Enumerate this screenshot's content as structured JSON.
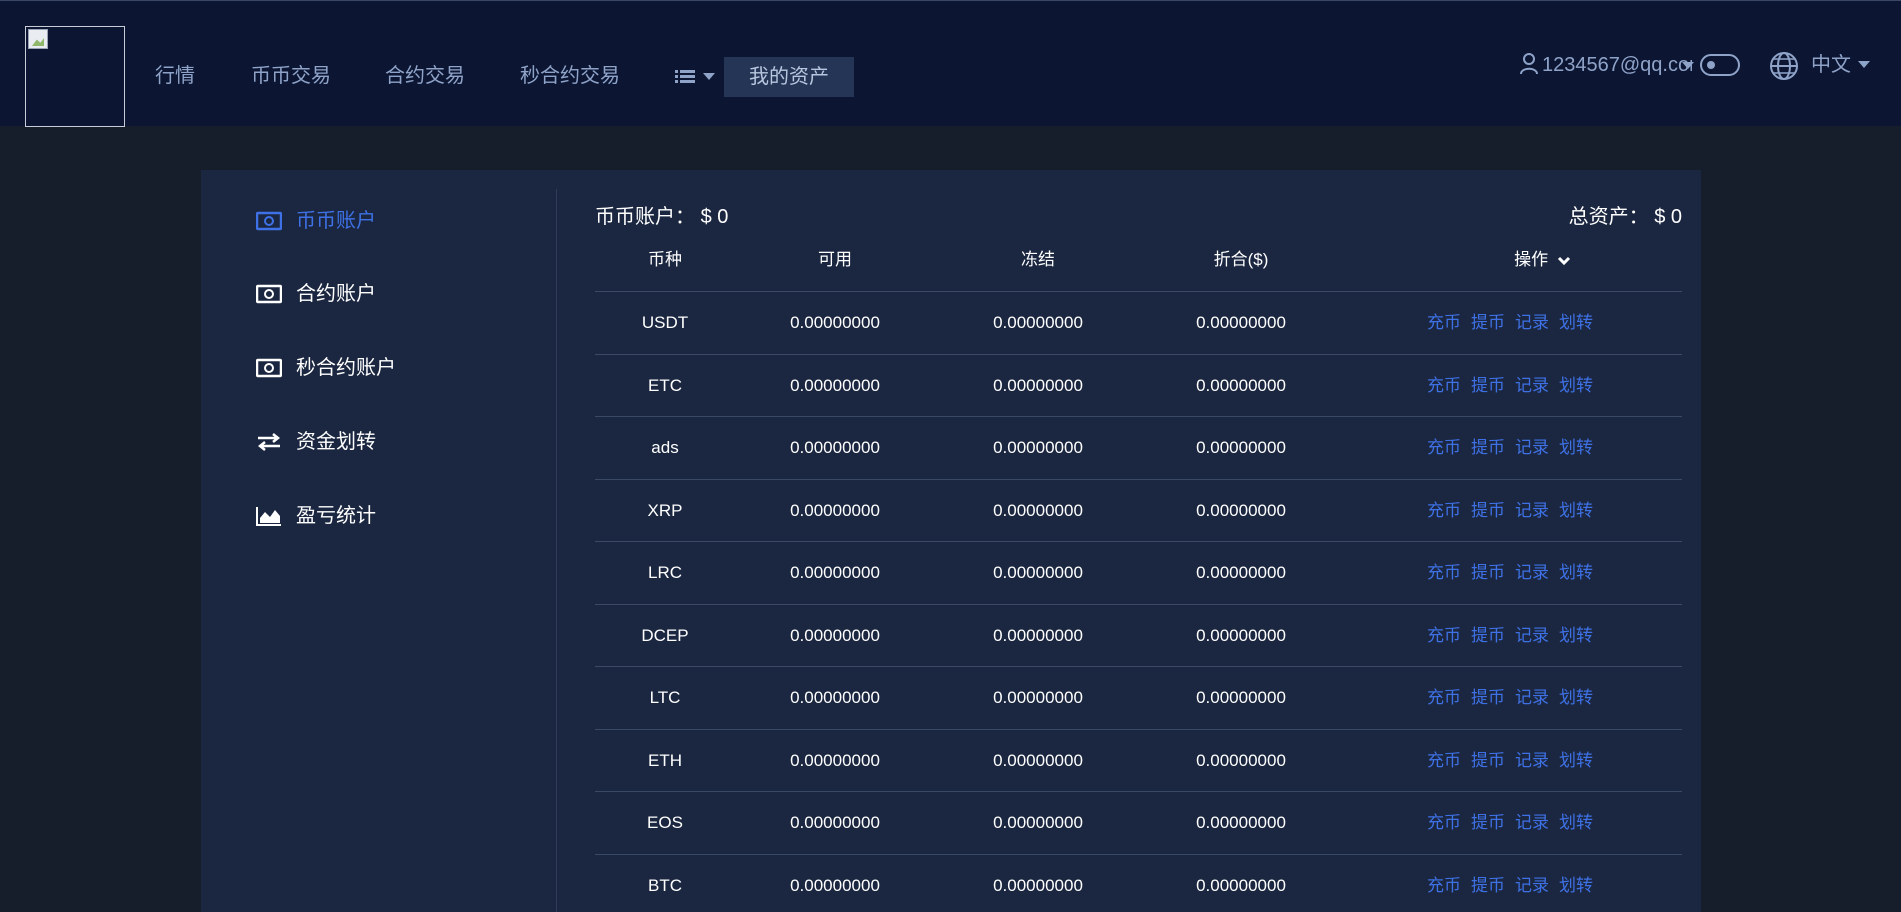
{
  "header": {
    "nav": [
      {
        "key": "market",
        "label": "行情"
      },
      {
        "key": "spot",
        "label": "币币交易"
      },
      {
        "key": "contract",
        "label": "合约交易"
      },
      {
        "key": "second_contract",
        "label": "秒合约交易"
      }
    ],
    "assets_label": "我的资产",
    "user_email": "1234567@qq.com",
    "language": "中文",
    "icons": [
      "list-icon",
      "user-icon",
      "toggle-switch",
      "globe-icon"
    ]
  },
  "sidebar": {
    "items": [
      {
        "label": "币币账户",
        "icon": "money-icon",
        "active": true
      },
      {
        "label": "合约账户",
        "icon": "money-icon",
        "active": false
      },
      {
        "label": "秒合约账户",
        "icon": "money-icon",
        "active": false
      },
      {
        "label": "资金划转",
        "icon": "transfer-icon",
        "active": false
      },
      {
        "label": "盈亏统计",
        "icon": "area-chart-icon",
        "active": false
      }
    ]
  },
  "account": {
    "title": "币币账户：",
    "value": "$ 0",
    "total_title": "总资产：",
    "total_value": "$ 0"
  },
  "table": {
    "headers": [
      "币种",
      "可用",
      "冻结",
      "折合($)",
      "操作"
    ],
    "actions": [
      "充币",
      "提币",
      "记录",
      "划转"
    ],
    "rows": [
      {
        "coin": "USDT",
        "available": "0.00000000",
        "frozen": "0.00000000",
        "value": "0.00000000"
      },
      {
        "coin": "ETC",
        "available": "0.00000000",
        "frozen": "0.00000000",
        "value": "0.00000000"
      },
      {
        "coin": "ads",
        "available": "0.00000000",
        "frozen": "0.00000000",
        "value": "0.00000000"
      },
      {
        "coin": "XRP",
        "available": "0.00000000",
        "frozen": "0.00000000",
        "value": "0.00000000"
      },
      {
        "coin": "LRC",
        "available": "0.00000000",
        "frozen": "0.00000000",
        "value": "0.00000000"
      },
      {
        "coin": "DCEP",
        "available": "0.00000000",
        "frozen": "0.00000000",
        "value": "0.00000000"
      },
      {
        "coin": "LTC",
        "available": "0.00000000",
        "frozen": "0.00000000",
        "value": "0.00000000"
      },
      {
        "coin": "ETH",
        "available": "0.00000000",
        "frozen": "0.00000000",
        "value": "0.00000000"
      },
      {
        "coin": "EOS",
        "available": "0.00000000",
        "frozen": "0.00000000",
        "value": "0.00000000"
      },
      {
        "coin": "BTC",
        "available": "0.00000000",
        "frozen": "0.00000000",
        "value": "0.00000000"
      }
    ]
  },
  "colors": {
    "header_bg": "#0c1633",
    "page_bg": "#171e2b",
    "panel_bg": "#1b2740",
    "accent": "#3e71e6",
    "nav_text": "#8fa3c9"
  }
}
